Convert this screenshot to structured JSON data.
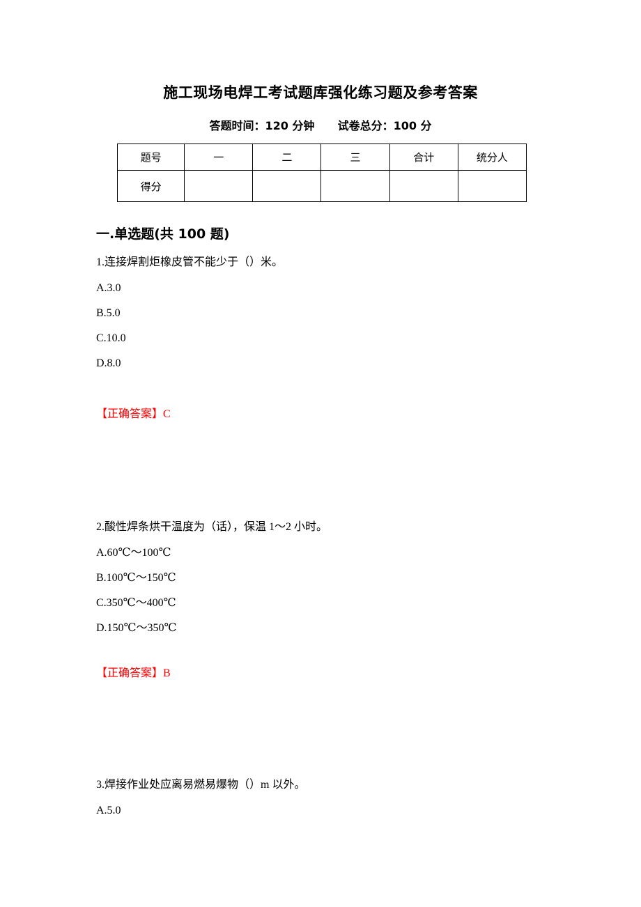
{
  "document": {
    "title": "施工现场电焊工考试题库强化练习题及参考答案",
    "subtitle": {
      "time_label": "答题时间：120 分钟",
      "total_label": "试卷总分：100 分"
    }
  },
  "score_table": {
    "headers": [
      "题号",
      "一",
      "二",
      "三",
      "合计",
      "统分人"
    ],
    "rows": [
      {
        "label": "得分",
        "cells": [
          "",
          "",
          "",
          "",
          ""
        ]
      }
    ]
  },
  "section": {
    "heading": "一.单选题(共 100 题)"
  },
  "answer_prefix": "【正确答案】",
  "questions": [
    {
      "number": "1.",
      "text": "1.连接焊割炬橡皮管不能少于（）米。",
      "options": [
        "A.3.0",
        "B.5.0",
        "C.10.0",
        "D.8.0"
      ],
      "answer_label": "【正确答案】",
      "answer": "C"
    },
    {
      "number": "2.",
      "text": "2.酸性焊条烘干温度为（话），保温 1～2 小时。",
      "options": [
        "A.60℃～100℃",
        "B.100℃～150℃",
        "C.350℃～400℃",
        "D.150℃～350℃"
      ],
      "answer_label": "【正确答案】",
      "answer": "B"
    },
    {
      "number": "3.",
      "text": "3.焊接作业处应离易燃易爆物（）m 以外。",
      "options": [
        "A.5.0"
      ],
      "answer_label": "",
      "answer": ""
    }
  ],
  "colors": {
    "answer_red": "#ff0000",
    "text": "#000000",
    "border": "#000000",
    "background": "#ffffff"
  }
}
